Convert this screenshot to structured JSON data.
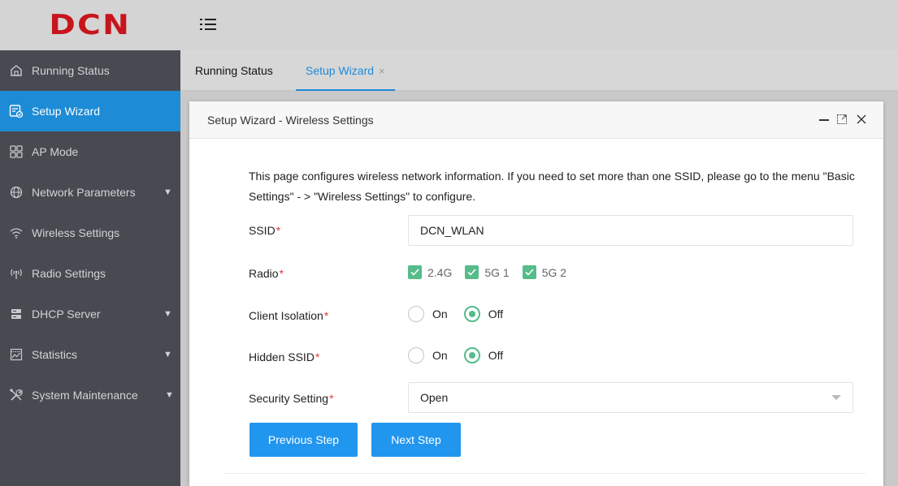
{
  "brand": {
    "logo_text": "DCN",
    "logo_color": "#c8141c"
  },
  "colors": {
    "accent": "#1d8bd5",
    "sidebar_bg": "#474a51",
    "check_green": "#55bc8a",
    "button_blue": "#2196ef",
    "required": "#e23b3b"
  },
  "sidebar": {
    "items": [
      {
        "label": "Running Status",
        "icon": "home-icon"
      },
      {
        "label": "Setup Wizard",
        "icon": "wizard-icon",
        "active": true
      },
      {
        "label": "AP Mode",
        "icon": "grid-icon"
      },
      {
        "label": "Network Parameters",
        "icon": "globe-icon",
        "has_caret": true
      },
      {
        "label": "Wireless Settings",
        "icon": "wifi-icon"
      },
      {
        "label": "Radio Settings",
        "icon": "radio-icon"
      },
      {
        "label": "DHCP Server",
        "icon": "server-icon",
        "has_caret": true
      },
      {
        "label": "Statistics",
        "icon": "chart-icon",
        "has_caret": true
      },
      {
        "label": "System Maintenance",
        "icon": "tools-icon",
        "has_caret": true
      }
    ]
  },
  "tabs": [
    {
      "label": "Running Status"
    },
    {
      "label": "Setup Wizard",
      "active": true,
      "close": "×"
    }
  ],
  "dialog": {
    "title": "Setup Wizard - Wireless Settings",
    "intro": "This page configures wireless network information. If you need to set more than one SSID, please go to the menu \"Basic Settings\" - > \"Wireless Settings\" to configure.",
    "required_mark": "*",
    "ssid": {
      "label": "SSID",
      "value": "DCN_WLAN"
    },
    "radio": {
      "label": "Radio",
      "options": [
        {
          "label": "2.4G",
          "checked": true
        },
        {
          "label": "5G 1",
          "checked": true
        },
        {
          "label": "5G 2",
          "checked": true
        }
      ]
    },
    "client_isolation": {
      "label": "Client Isolation",
      "on_label": "On",
      "off_label": "Off",
      "selected": "Off"
    },
    "hidden_ssid": {
      "label": "Hidden SSID",
      "on_label": "On",
      "off_label": "Off",
      "selected": "Off"
    },
    "security": {
      "label": "Security Setting",
      "value": "Open"
    },
    "buttons": {
      "previous": "Previous Step",
      "next": "Next Step"
    }
  }
}
